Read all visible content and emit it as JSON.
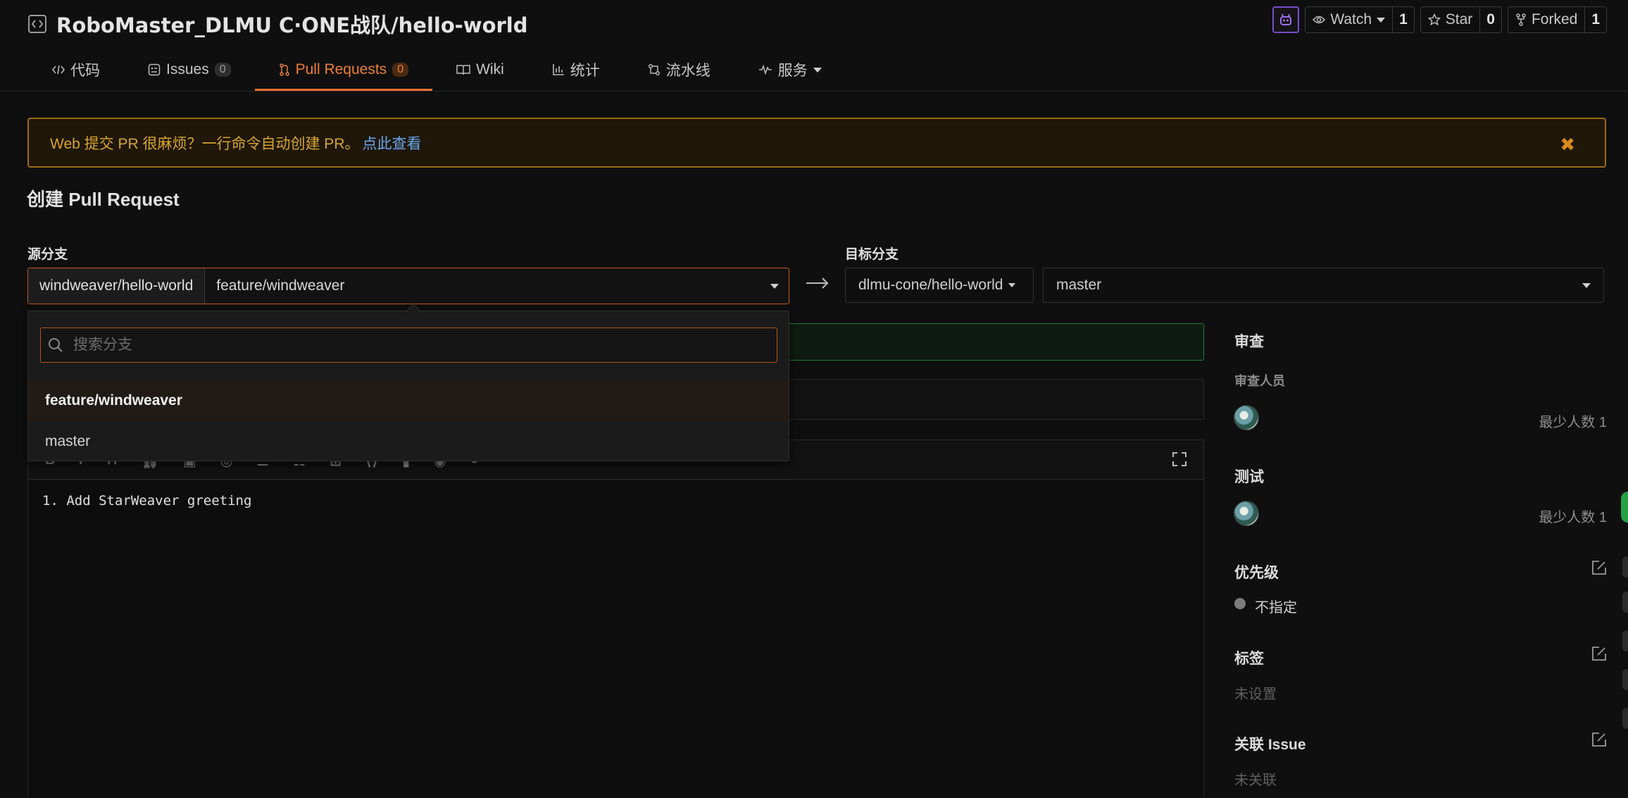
{
  "repo": {
    "title": "RoboMaster_DLMU C·ONE战队/hello-world"
  },
  "actions": {
    "watch_label": "Watch",
    "watch_count": "1",
    "star_label": "Star",
    "star_count": "0",
    "forked_label": "Forked",
    "forked_count": "1"
  },
  "tabs": [
    {
      "label": "代码",
      "badge": ""
    },
    {
      "label": "Issues",
      "badge": "0"
    },
    {
      "label": "Pull Requests",
      "badge": "0"
    },
    {
      "label": "Wiki",
      "badge": ""
    },
    {
      "label": "统计",
      "badge": ""
    },
    {
      "label": "流水线",
      "badge": ""
    },
    {
      "label": "服务",
      "badge": ""
    }
  ],
  "banner": {
    "text": "Web 提交 PR 很麻烦？一行命令自动创建 PR。",
    "link": "点此查看",
    "close": "✖"
  },
  "page": {
    "title": "创建 Pull Request"
  },
  "source": {
    "label": "源分支",
    "repo": "windweaver/hello-world",
    "branch": "feature/windweaver"
  },
  "target": {
    "label": "目标分支",
    "repo": "dlmu-cone/hello-world",
    "branch": "master"
  },
  "dropdown": {
    "search_placeholder": "搜索分支",
    "items": [
      "feature/windweaver",
      "master"
    ]
  },
  "editor": {
    "content": "1. Add StarWeaver greeting"
  },
  "sidebar": {
    "review": {
      "title": "审查",
      "sub": "审查人员",
      "min": "最少人数 1"
    },
    "test": {
      "title": "测试",
      "min": "最少人数 1"
    },
    "priority": {
      "title": "优先级",
      "value": "不指定"
    },
    "labels": {
      "title": "标签",
      "value": "未设置"
    },
    "issue": {
      "title": "关联 Issue",
      "value": "未关联"
    }
  },
  "colors": {
    "accent": "#e8712d",
    "banner_border": "#9c6a12",
    "link": "#69a8f0",
    "success_border": "#237a35"
  }
}
